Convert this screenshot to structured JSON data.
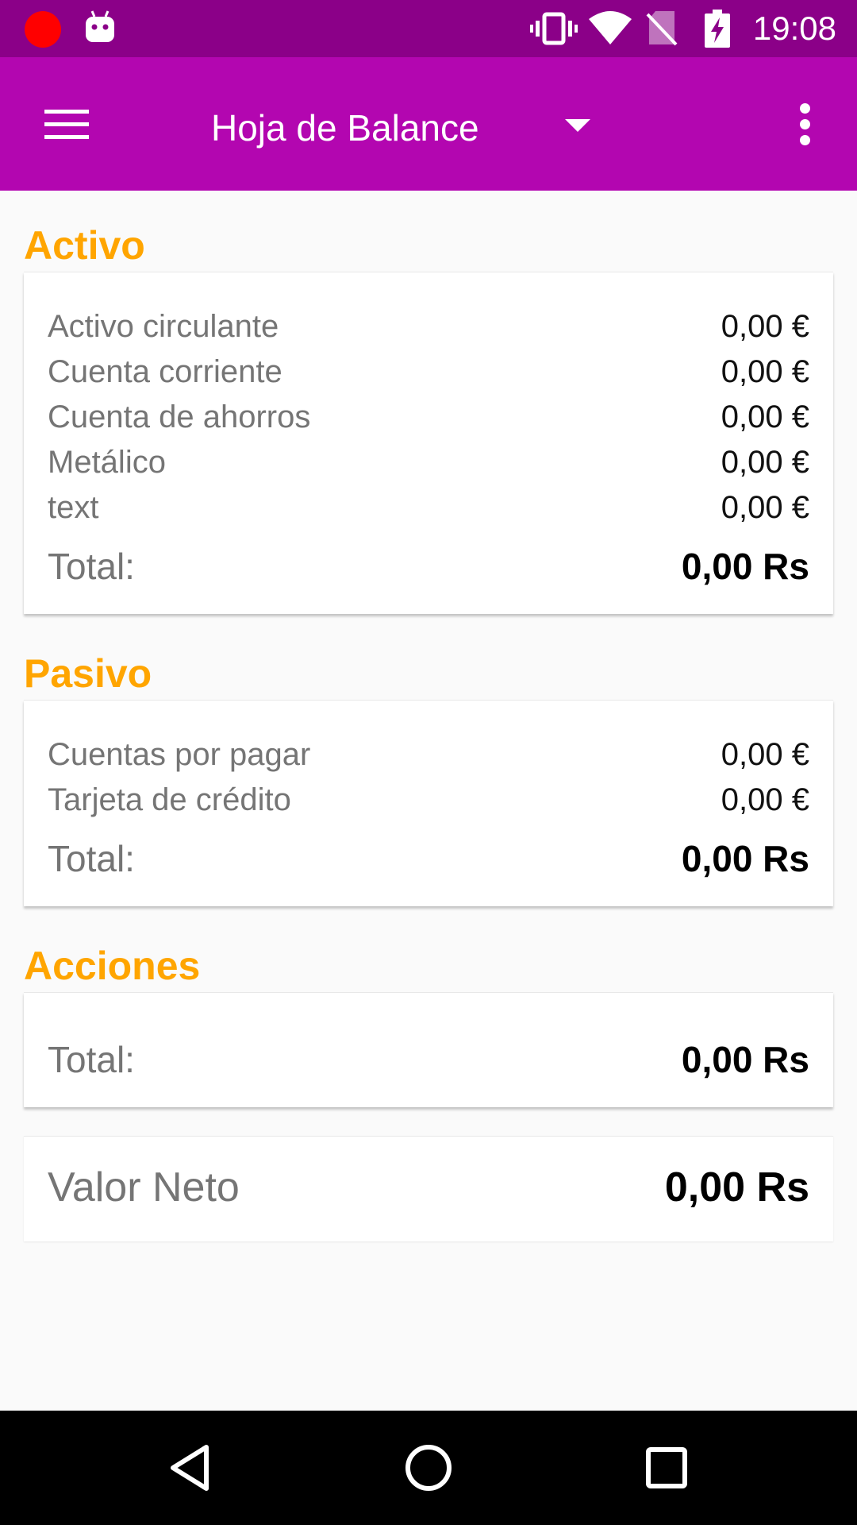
{
  "status_bar": {
    "time": "19:08",
    "icons": [
      "record-dot-icon",
      "android-icon",
      "vibrate-icon",
      "wifi-icon",
      "no-sim-icon",
      "battery-charging-icon"
    ],
    "record_color": "#ff0000"
  },
  "app_bar": {
    "title": "Hoja de Balance",
    "color": "#b306b0",
    "status_color": "#8b0088",
    "icons": [
      "menu-icon",
      "dropdown-arrow-icon",
      "more-vert-icon"
    ]
  },
  "accent_color": "#ffa500",
  "sections": {
    "activo": {
      "title": "Activo",
      "items": [
        {
          "label": "Activo circulante",
          "value": "0,00 €"
        },
        {
          "label": "Cuenta corriente",
          "value": "0,00 €"
        },
        {
          "label": "Cuenta de ahorros",
          "value": "0,00 €"
        },
        {
          "label": "Metálico",
          "value": "0,00 €"
        },
        {
          "label": "text",
          "value": "0,00 €"
        }
      ],
      "total_label": "Total:",
      "total_value": "0,00 Rs"
    },
    "pasivo": {
      "title": "Pasivo",
      "items": [
        {
          "label": "Cuentas por pagar",
          "value": "0,00 €"
        },
        {
          "label": "Tarjeta de crédito",
          "value": "0,00 €"
        }
      ],
      "total_label": "Total:",
      "total_value": "0,00 Rs"
    },
    "acciones": {
      "title": "Acciones",
      "items": [],
      "total_label": "Total:",
      "total_value": "0,00 Rs"
    }
  },
  "net_worth": {
    "label": "Valor Neto",
    "value": "0,00 Rs"
  },
  "nav_bar": {
    "buttons": [
      "back-icon",
      "home-icon",
      "recents-icon"
    ]
  }
}
